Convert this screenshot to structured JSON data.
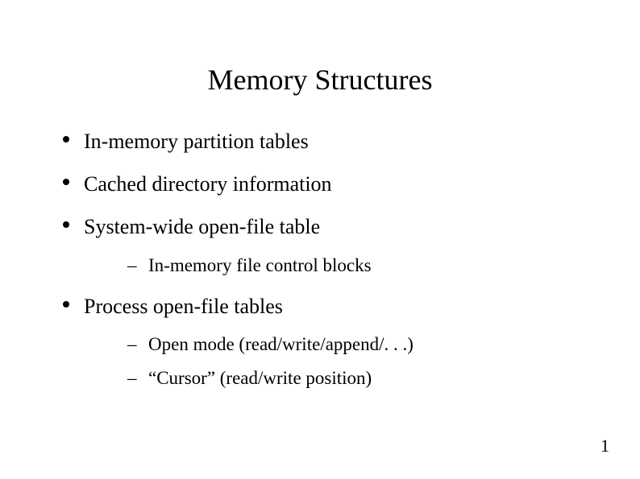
{
  "title": "Memory Structures",
  "bullets": {
    "b1": "In-memory partition tables",
    "b2": "Cached directory information",
    "b3": "System-wide open-file table",
    "b3_sub1": "In-memory file control blocks",
    "b4": "Process open-file tables",
    "b4_sub1": "Open mode (read/write/append/. . .)",
    "b4_sub2": "“Cursor” (read/write position)"
  },
  "page_number": "1"
}
